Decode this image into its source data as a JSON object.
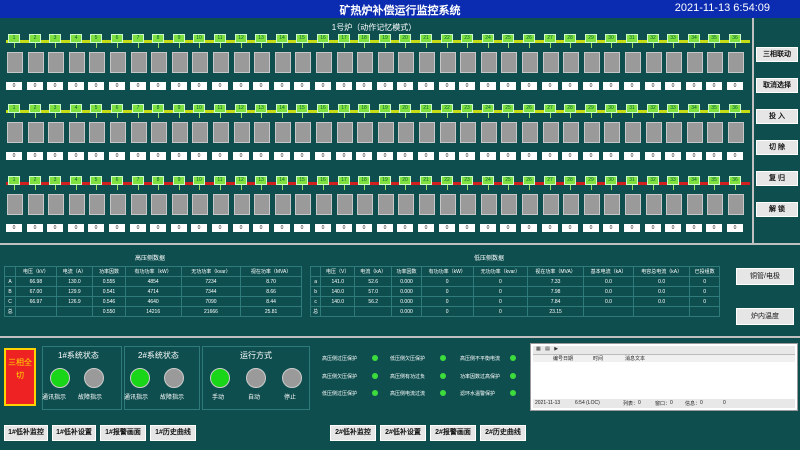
{
  "header": {
    "title": "矿热炉补偿运行监控系统",
    "datetime": "2021-11-13  6:54:09"
  },
  "furnace_title": "1号炉（动作记忆模式）",
  "rows": [
    {
      "bus_color": "#c6dc14",
      "counts": [
        "0",
        "0",
        "0",
        "0",
        "0",
        "0",
        "0",
        "0",
        "0",
        "0",
        "0",
        "0",
        "0",
        "0",
        "0",
        "0",
        "0",
        "0",
        "0",
        "0",
        "0",
        "0",
        "0",
        "0",
        "0",
        "0",
        "0",
        "0",
        "0",
        "0",
        "0",
        "0",
        "0",
        "0",
        "0",
        "0"
      ]
    },
    {
      "bus_color": "#c6dc14",
      "counts": [
        "0",
        "0",
        "0",
        "0",
        "0",
        "0",
        "0",
        "0",
        "0",
        "0",
        "0",
        "0",
        "0",
        "0",
        "0",
        "0",
        "0",
        "0",
        "0",
        "0",
        "0",
        "0",
        "0",
        "0",
        "0",
        "0",
        "0",
        "0",
        "0",
        "0",
        "0",
        "0",
        "0",
        "0",
        "0",
        "0"
      ]
    },
    {
      "bus_color": "#d02020",
      "counts": [
        "0",
        "0",
        "0",
        "0",
        "0",
        "0",
        "0",
        "0",
        "0",
        "0",
        "0",
        "0",
        "0",
        "0",
        "0",
        "0",
        "0",
        "0",
        "0",
        "0",
        "0",
        "0",
        "0",
        "0",
        "0",
        "0",
        "0",
        "0",
        "0",
        "0",
        "0",
        "0",
        "0",
        "0",
        "0",
        "0"
      ]
    }
  ],
  "cap_numbers": [
    "1",
    "2",
    "3",
    "4",
    "5",
    "6",
    "7",
    "8",
    "9",
    "10",
    "11",
    "12",
    "13",
    "14",
    "15",
    "16",
    "17",
    "18",
    "19",
    "20",
    "21",
    "22",
    "23",
    "24",
    "25",
    "26",
    "27",
    "28",
    "29",
    "30",
    "31",
    "32",
    "33",
    "34",
    "35",
    "36"
  ],
  "right_buttons": [
    "三相联动",
    "取消选择",
    "投 入",
    "切 除",
    "复 归",
    "解 锁"
  ],
  "hv_table": {
    "title": "高压侧数据",
    "headers": [
      "",
      "电压（kV）",
      "电流（A）",
      "功率因数",
      "有功功率（kW）",
      "无功功率（kvar）",
      "视在功率（MVA）"
    ],
    "rows": [
      [
        "A",
        "66.98",
        "130.0",
        "0.555",
        "4854",
        "7234",
        "8.70"
      ],
      [
        "B",
        "67.00",
        "129.9",
        "0.541",
        "4714",
        "7344",
        "8.66"
      ],
      [
        "C",
        "66.97",
        "126.9",
        "0.546",
        "4640",
        "7090",
        "8.44"
      ],
      [
        "总",
        "",
        "",
        "0.550",
        "14216",
        "21666",
        "25.81"
      ]
    ]
  },
  "lv_table": {
    "title": "低压侧数据",
    "headers": [
      "",
      "电压（V）",
      "电流（kA）",
      "功率因数",
      "有功功率（kW）",
      "无功功率（kvar）",
      "视在功率（MVA）",
      "基本电流（kA）",
      "电容总电流（kA）",
      "已投组数"
    ],
    "rows": [
      [
        "a",
        "141.0",
        "52.6",
        "0.000",
        "0",
        "0",
        "7.33",
        "0.0",
        "0.0",
        "0"
      ],
      [
        "b",
        "140.0",
        "57.0",
        "0.000",
        "0",
        "0",
        "7.98",
        "0.0",
        "0.0",
        "0"
      ],
      [
        "c",
        "140.0",
        "56.2",
        "0.000",
        "0",
        "0",
        "7.84",
        "0.0",
        "0.0",
        "0"
      ],
      [
        "总",
        "",
        "",
        "0.000",
        "0",
        "0",
        "23.15",
        "",
        "",
        ""
      ]
    ]
  },
  "side_buttons": [
    "铜管/电极",
    "炉内温度"
  ],
  "alltrip": {
    "label": "三相全切"
  },
  "sys1": {
    "title": "1#系统状态",
    "lamps": [
      {
        "label": "通讯指示",
        "color": "#19d619"
      },
      {
        "label": "故障指示",
        "color": "#9a9a9a"
      }
    ]
  },
  "sys2": {
    "title": "2#系统状态",
    "lamps": [
      {
        "label": "通讯指示",
        "color": "#19d619"
      },
      {
        "label": "故障指示",
        "color": "#9a9a9a"
      }
    ]
  },
  "mode": {
    "title": "运行方式",
    "lamps": [
      {
        "label": "手动",
        "color": "#19d619"
      },
      {
        "label": "自动",
        "color": "#9a9a9a"
      },
      {
        "label": "停止",
        "color": "#9a9a9a"
      }
    ]
  },
  "protections": [
    [
      "高压侧过压保护",
      "低压侧欠压保护",
      "高压侧不平衡电流"
    ],
    [
      "高压侧欠压保护",
      "高压侧有功过负",
      "功率因数过高保护"
    ],
    [
      "低压侧过压保护",
      "高压侧电流过流",
      "滤环水温警保护"
    ]
  ],
  "eventlog": {
    "columns": [
      "编号",
      "日期",
      "时间",
      "消息文本"
    ],
    "footer": [
      "2021-11-13",
      "6:54 (LOC)",
      "列表：",
      "0",
      "窗口：",
      "0",
      "信息：",
      "0",
      "0"
    ]
  },
  "bottom_buttons": [
    "1#低补监控",
    "1#低补设置",
    "1#报警画面",
    "1#历史曲线",
    "2#低补监控",
    "2#低补设置",
    "2#报警画面",
    "2#历史曲线"
  ]
}
